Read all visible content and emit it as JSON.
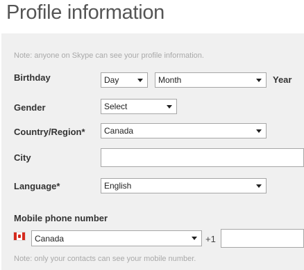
{
  "page": {
    "title": "Profile information"
  },
  "notes": {
    "top": "Note: anyone on Skype can see your profile information.",
    "bottom": "Note: only your contacts can see your mobile number."
  },
  "birthday": {
    "label": "Birthday",
    "day": "Day",
    "month": "Month",
    "year_label": "Year"
  },
  "gender": {
    "label": "Gender",
    "value": "Select"
  },
  "country": {
    "label": "Country/Region*",
    "value": "Canada"
  },
  "city": {
    "label": "City",
    "value": ""
  },
  "language": {
    "label": "Language*",
    "value": "English"
  },
  "mobile": {
    "label": "Mobile phone number",
    "country_value": "Canada",
    "country_code": "+1",
    "number": "",
    "flag_icon": "canada-flag-icon"
  },
  "colors": {
    "panel_bg": "#f0f0f0",
    "title": "#555555",
    "note": "#a9a9a9",
    "flag_red": "#d52b1e"
  }
}
